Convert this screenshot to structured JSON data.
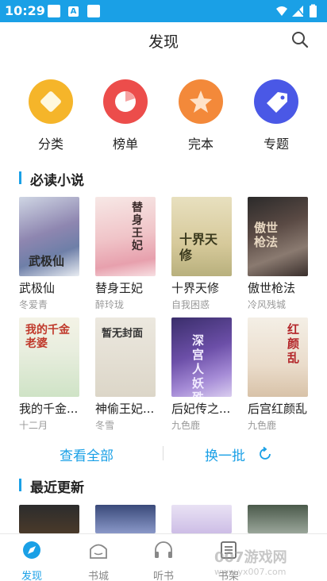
{
  "status": {
    "time": "10:29",
    "icon_a": "A"
  },
  "header": {
    "title": "发现"
  },
  "categories": [
    {
      "label": "分类",
      "color": "#f5b52a",
      "icon": "category-icon"
    },
    {
      "label": "榜单",
      "color": "#ec4d4b",
      "icon": "ranking-icon"
    },
    {
      "label": "完本",
      "color": "#f3893a",
      "icon": "star-icon"
    },
    {
      "label": "专题",
      "color": "#4a58e6",
      "icon": "tag-icon"
    }
  ],
  "section_must_read": {
    "title": "必读小说"
  },
  "books": [
    {
      "name": "武极仙",
      "author": "冬爱青",
      "cover_text": "武极仙"
    },
    {
      "name": "替身王妃",
      "author": "醉玲珑",
      "cover_text": "替身王妃"
    },
    {
      "name": "十界天修",
      "author": "自我困惑",
      "cover_text": "十界天修"
    },
    {
      "name": "傲世枪法",
      "author": "冷风残城",
      "cover_text": "傲世枪法"
    },
    {
      "name": "我的千金...",
      "author": "十二月",
      "cover_text": "我的千金老婆"
    },
    {
      "name": "神偷王妃...",
      "author": "冬雪",
      "cover_text": "暂无封面"
    },
    {
      "name": "后妃传之...",
      "author": "九色鹿",
      "cover_text": "深宫人妖殊"
    },
    {
      "name": "后宫红颜乱",
      "author": "九色鹿",
      "cover_text": "红颜乱"
    }
  ],
  "actions": {
    "view_all": "查看全部",
    "refresh": "换一批"
  },
  "section_recent": {
    "title": "最近更新"
  },
  "tabs": [
    {
      "label": "发现",
      "active": true
    },
    {
      "label": "书城",
      "active": false
    },
    {
      "label": "听书",
      "active": false
    },
    {
      "label": "书架",
      "active": false
    }
  ],
  "watermark": {
    "line1": "007游戏网",
    "line2": "www.yx007.com"
  },
  "colors": {
    "accent": "#1aa0e6"
  }
}
